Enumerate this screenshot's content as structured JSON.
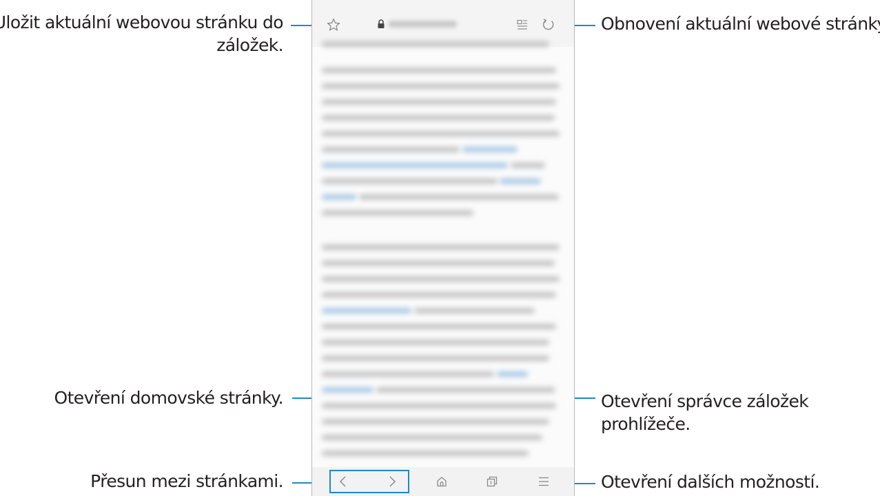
{
  "callouts": {
    "bookmark": "Uložit aktuální webovou stránku do záložek.",
    "bookmark_line1": "Uložit aktuální webovou stránku do",
    "bookmark_line2": "záložek.",
    "refresh": "Obnovení aktuální webové stránky.",
    "home": "Otevření domovské stránky.",
    "tabs_line1": "Otevření správce záložek",
    "tabs_line2": "prohlížeče.",
    "navigation": "Přesun mezi stránkami.",
    "more": "Otevření dalších možností."
  },
  "icons": {
    "bookmark": "star-outline-icon",
    "lock": "lock-icon",
    "reader": "reader-mode-icon",
    "refresh": "refresh-icon",
    "back": "chevron-left-icon",
    "forward": "chevron-right-icon",
    "home": "home-icon",
    "tabs": "tabs-icon",
    "menu": "menu-icon"
  },
  "colors": {
    "callout_line": "#1a8ac9",
    "text": "#231f20",
    "icon": "#8a8a8a"
  }
}
